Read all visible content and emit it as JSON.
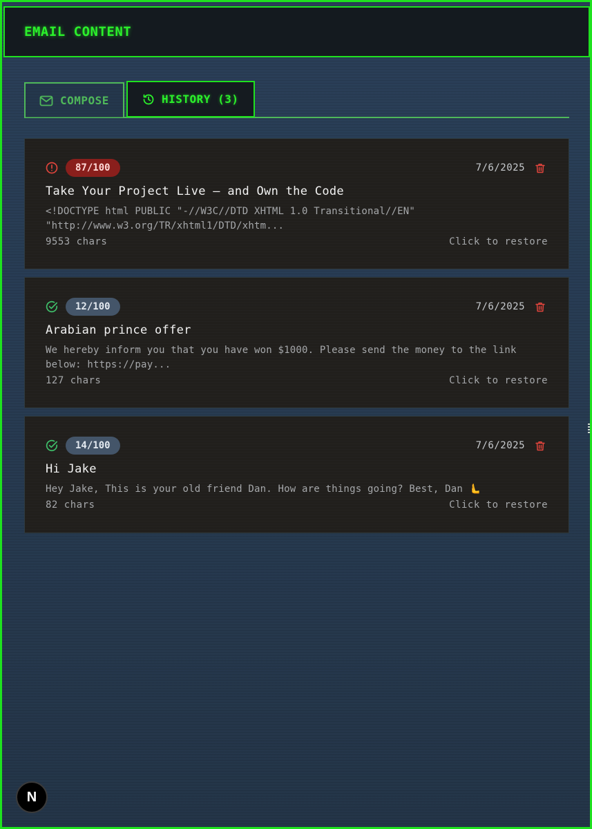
{
  "header": {
    "title": "EMAIL CONTENT"
  },
  "tabs": [
    {
      "label": "COMPOSE",
      "icon": "mail-icon",
      "active": false
    },
    {
      "label": "HISTORY (3)",
      "icon": "history-icon",
      "active": true
    }
  ],
  "history": [
    {
      "status": "warning",
      "score": "87/100",
      "date": "7/6/2025",
      "title": "Take Your Project Live — and Own the Code",
      "preview": "<!DOCTYPE html PUBLIC \"-//W3C//DTD XHTML 1.0 Transitional//EN\"\n\"http://www.w3.org/TR/xhtml1/DTD/xhtm...",
      "chars": "9553 chars",
      "action": "Click to restore"
    },
    {
      "status": "ok",
      "score": "12/100",
      "date": "7/6/2025",
      "title": "Arabian prince offer",
      "preview": "We hereby inform you that you have won $1000. Please send the money to the link\nbelow: https://pay...",
      "chars": "127 chars",
      "action": "Click to restore"
    },
    {
      "status": "ok",
      "score": "14/100",
      "date": "7/6/2025",
      "title": "Hi Jake",
      "preview": "Hey Jake, This is your old friend Dan. How are things going? Best, Dan 🫷",
      "chars": "82 chars",
      "action": "Click to restore"
    }
  ],
  "colors": {
    "accent": "#1fe21f",
    "tab_inactive": "#4fb85a",
    "danger": "#e0443c",
    "ok": "#3fbf6a",
    "card_bg": "#211f1c",
    "page_bg": "#283c53"
  },
  "dev_badge": {
    "label": "N"
  }
}
